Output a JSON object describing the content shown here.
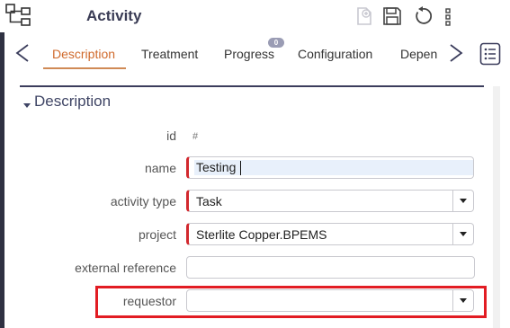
{
  "header": {
    "title": "Activity",
    "icons": {
      "tree": "tree-structure-icon",
      "new": "new-document-icon",
      "save": "save-icon",
      "undo": "undo-icon",
      "more": "more-vertical-icon"
    }
  },
  "tabs": [
    {
      "label": "Description",
      "active": true
    },
    {
      "label": "Treatment",
      "active": false
    },
    {
      "label": "Progress",
      "active": false,
      "badge": "0"
    },
    {
      "label": "Configuration",
      "active": false
    },
    {
      "label": "Depen",
      "active": false
    }
  ],
  "section": {
    "title": "Description"
  },
  "form": {
    "id": {
      "label": "id",
      "value": "#"
    },
    "name": {
      "label": "name",
      "value": "Testing"
    },
    "activity_type": {
      "label": "activity type",
      "value": "Task"
    },
    "project": {
      "label": "project",
      "value": "Sterlite Copper.BPEMS"
    },
    "external_reference": {
      "label": "external reference",
      "value": ""
    },
    "requestor": {
      "label": "requestor",
      "value": ""
    }
  },
  "colors": {
    "accent": "#d06a2c",
    "required": "#d2282e",
    "highlight": "#e21c23",
    "title": "#3a3c55"
  }
}
